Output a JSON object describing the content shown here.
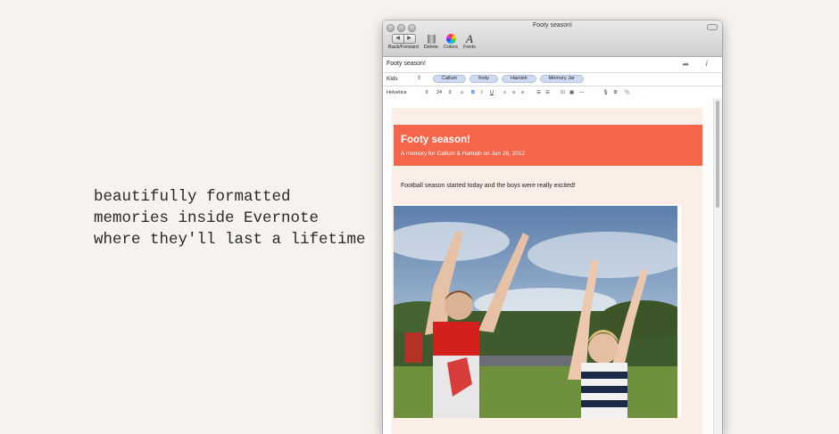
{
  "tagline": {
    "line1": "beautifully formatted",
    "line2": "memories inside Evernote",
    "line3": "where they'll last a lifetime"
  },
  "window": {
    "title": "Footy season!",
    "toolbar": {
      "back_forward_label": "Back/Forward",
      "delete_label": "Delete",
      "colors_label": "Colors",
      "fonts_label": "Fonts",
      "back_glyph": "◀",
      "forward_glyph": "▶"
    },
    "note_title": "Footy season!",
    "notebook": "Kids",
    "tags": [
      "Callum",
      "footy",
      "Hamish",
      "Memory Jar"
    ],
    "format": {
      "font": "Helvetica",
      "size": "24",
      "bold": "B",
      "italic": "I",
      "underline": "U"
    }
  },
  "note": {
    "banner_title": "Footy season!",
    "banner_subtitle": "A memory for Callum & Hamish on Jun 28, 2012",
    "body": "Football season started today and the boys were really excited!"
  },
  "colors": {
    "banner": "#f4654a",
    "card": "#fbeee6",
    "tag": "#cfd9f1",
    "page_bg": "#f6f2ee"
  },
  "icons": [
    "back-icon",
    "forward-icon",
    "trash-icon",
    "color-wheel-icon",
    "fonts-icon",
    "share-icon",
    "info-icon",
    "microphone-icon",
    "gear-icon",
    "paperclip-icon"
  ]
}
